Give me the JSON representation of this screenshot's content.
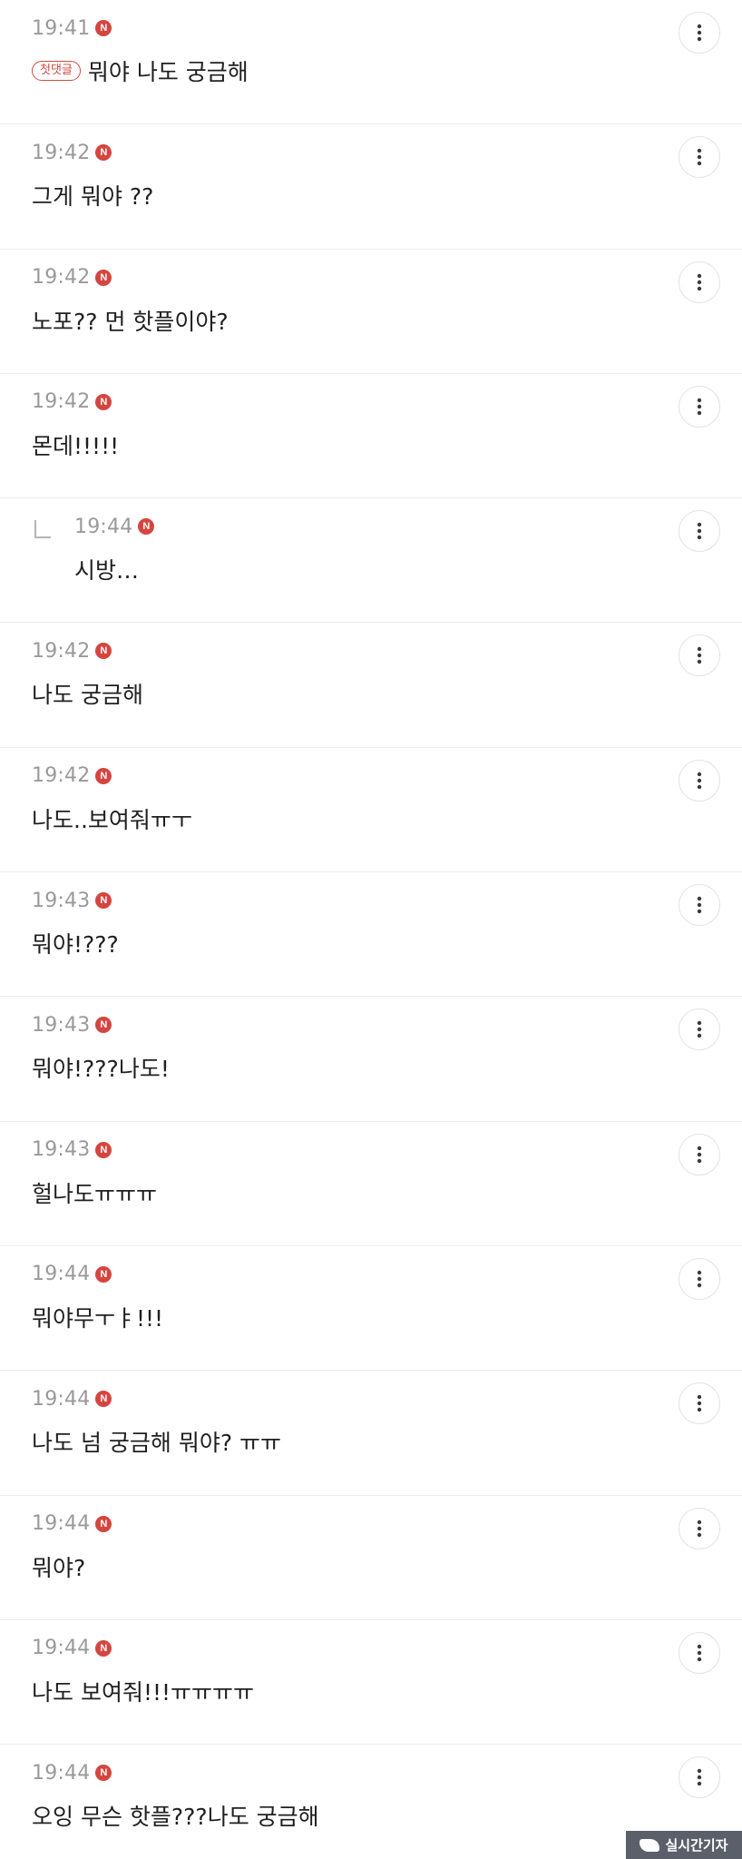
{
  "comments": [
    {
      "time": "19:41",
      "new_badge": "N",
      "first_badge": "첫댓글",
      "text": "뭐야 나도 궁금해"
    },
    {
      "time": "19:42",
      "new_badge": "N",
      "text": "그게 뭐야 ??"
    },
    {
      "time": "19:42",
      "new_badge": "N",
      "text": "노포?? 먼 핫플이야?"
    },
    {
      "time": "19:42",
      "new_badge": "N",
      "text": "몬데!!!!!"
    },
    {
      "time": "19:44",
      "new_badge": "N",
      "text": "시방…",
      "reply": true
    },
    {
      "time": "19:42",
      "new_badge": "N",
      "text": "나도 궁금해"
    },
    {
      "time": "19:42",
      "new_badge": "N",
      "text": "나도..보여줘ㅠㅜ"
    },
    {
      "time": "19:43",
      "new_badge": "N",
      "text": "뭐야!???"
    },
    {
      "time": "19:43",
      "new_badge": "N",
      "text": "뭐야!???나도!"
    },
    {
      "time": "19:43",
      "new_badge": "N",
      "text": "헐나도ㅠㅠㅠ"
    },
    {
      "time": "19:44",
      "new_badge": "N",
      "text": "뭐야무ㅜㅑ!!!"
    },
    {
      "time": "19:44",
      "new_badge": "N",
      "text": "나도 넘 궁금해 뭐야? ㅠㅠ"
    },
    {
      "time": "19:44",
      "new_badge": "N",
      "text": "뭐야?"
    },
    {
      "time": "19:44",
      "new_badge": "N",
      "text": "나도 보여줘!!!ㅠㅠㅠㅠ"
    },
    {
      "time": "19:44",
      "new_badge": "N",
      "text": "오잉 무슨 핫플???나도 궁금해"
    }
  ],
  "icons": {
    "more": "more-vertical-icon",
    "reply": "reply-arrow-icon"
  },
  "colors": {
    "badge_red": "#d5453f",
    "time_gray": "#9a9a9a",
    "first_badge": "#d04a3e"
  },
  "watermark": {
    "text": "실시간기자"
  }
}
